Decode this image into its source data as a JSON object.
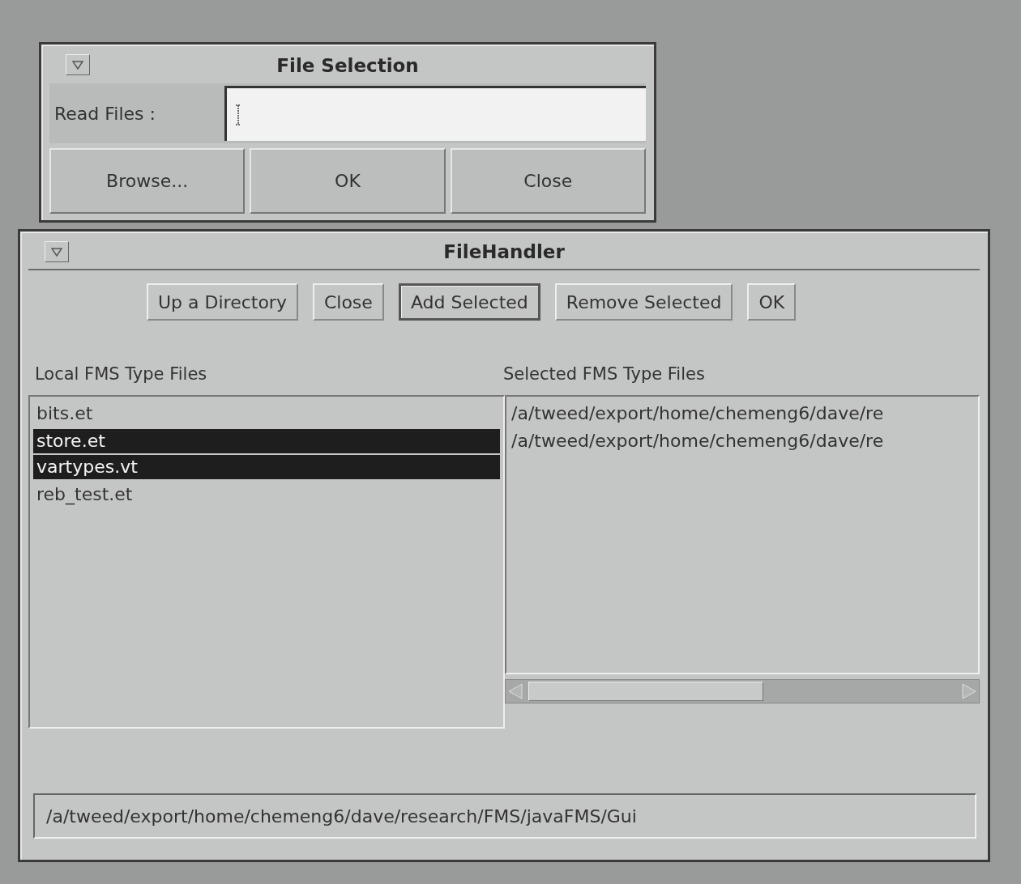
{
  "file_selection": {
    "title": "File Selection",
    "read_files_label": "Read Files :",
    "buttons": [
      {
        "label": "Browse..."
      },
      {
        "label": "OK"
      },
      {
        "label": "Close"
      }
    ]
  },
  "file_handler": {
    "title": "FileHandler",
    "buttons": [
      {
        "label": "Up a Directory",
        "default": false
      },
      {
        "label": "Close",
        "default": false
      },
      {
        "label": "Add Selected",
        "default": true
      },
      {
        "label": "Remove Selected",
        "default": false
      },
      {
        "label": "OK",
        "default": false
      }
    ],
    "local_files": {
      "label": "Local FMS Type Files",
      "items": [
        {
          "name": "bits.et",
          "selected": false
        },
        {
          "name": "store.et",
          "selected": true
        },
        {
          "name": "vartypes.vt",
          "selected": true
        },
        {
          "name": "reb_test.et",
          "selected": false
        }
      ]
    },
    "selected_files": {
      "label": "Selected FMS Type Files",
      "items": [
        "/a/tweed/export/home/chemeng6/dave/re",
        "/a/tweed/export/home/chemeng6/dave/re"
      ]
    },
    "path": "/a/tweed/export/home/chemeng6/dave/research/FMS/javaFMS/Gui"
  }
}
